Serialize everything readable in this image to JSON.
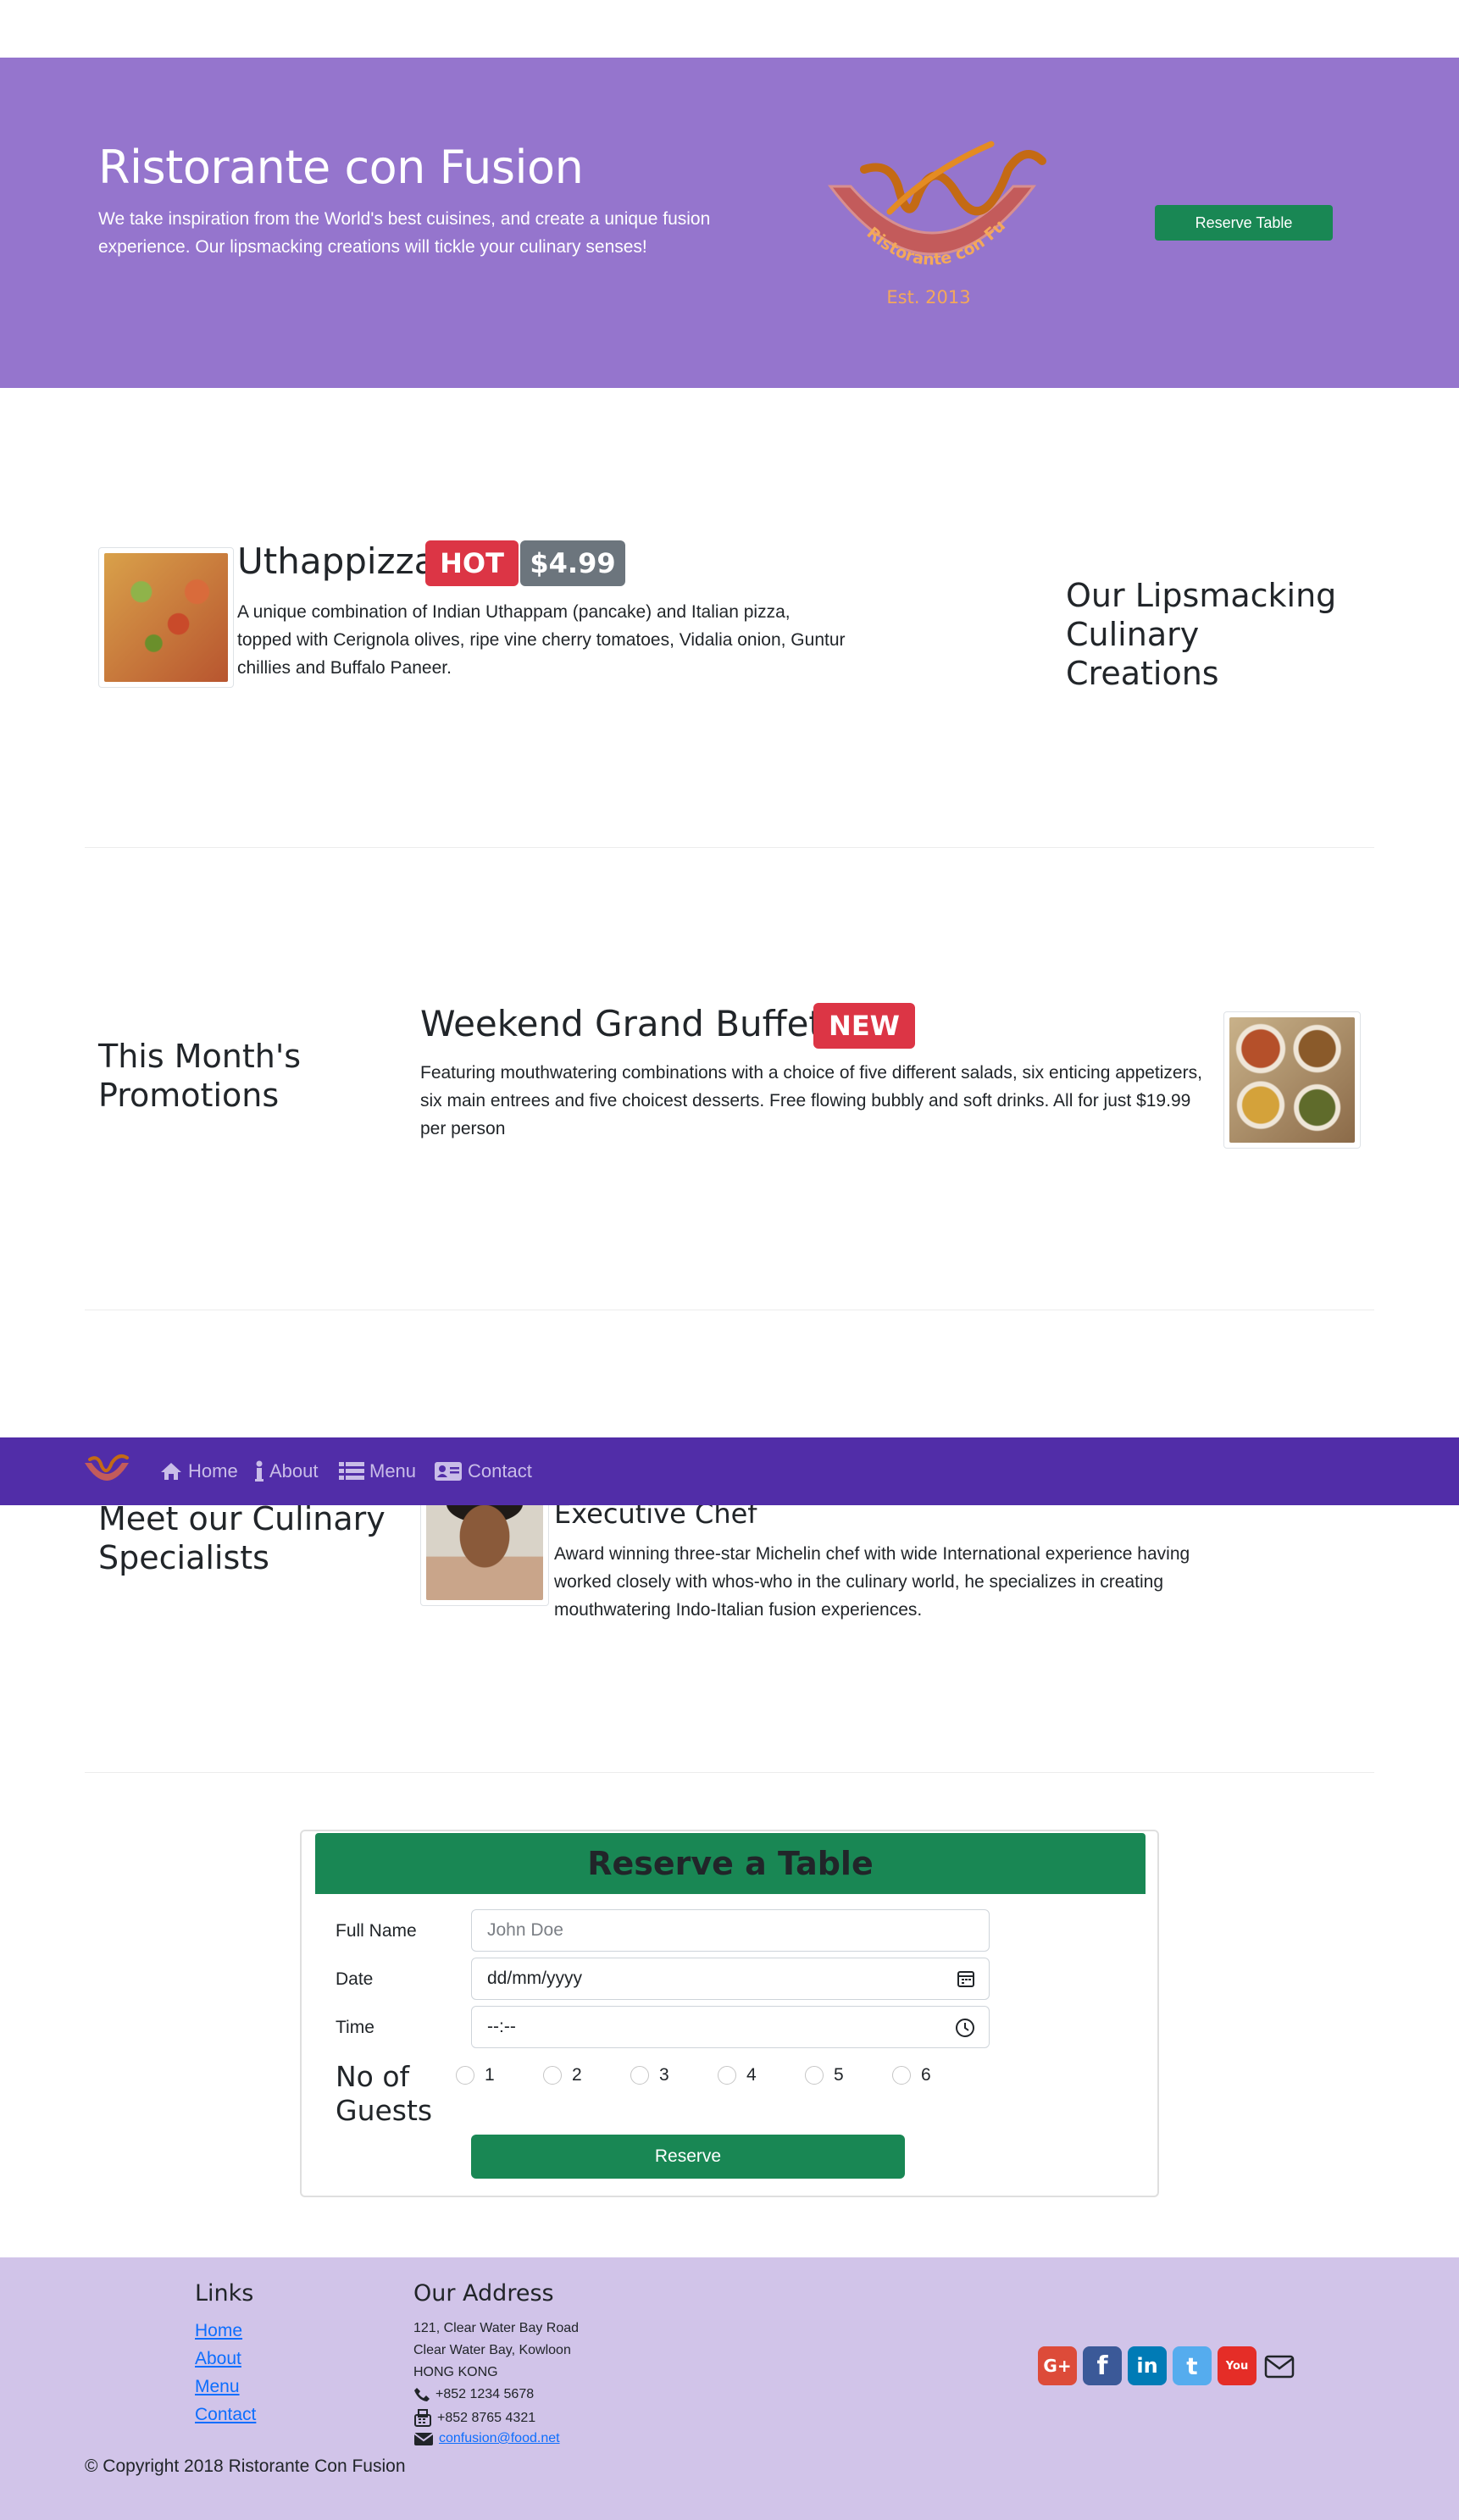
{
  "jumbotron": {
    "title": "Ristorante con Fusion",
    "description": "We take inspiration from the World's best cuisines, and create a unique fusion experience. Our lipsmacking creations will tickle your culinary senses!",
    "logo_text": "Ristorante con Fusion",
    "logo_est": "Est. 2013",
    "reserve_button": "Reserve Table"
  },
  "dish": {
    "name": "Uthappizza",
    "badge": "HOT",
    "price": "$4.99",
    "description": "A unique combination of Indian Uthappam (pancake) and Italian pizza, topped with Cerignola olives, ripe vine cherry tomatoes, Vidalia onion, Guntur chillies and Buffalo Paneer.",
    "section_heading": "Our Lipsmacking Culinary Creations"
  },
  "promotion": {
    "section_heading": "This Month's Promotions",
    "name": "Weekend Grand Buffet",
    "badge": "NEW",
    "description": "Featuring mouthwatering combinations with a choice of five different salads, six enticing appetizers, six main entrees and five choicest desserts. Free flowing bubbly and soft drinks. All for just $19.99 per person"
  },
  "navbar": {
    "items": [
      {
        "label": "Home",
        "icon": "home-icon"
      },
      {
        "label": "About",
        "icon": "info-icon"
      },
      {
        "label": "Menu",
        "icon": "list-icon"
      },
      {
        "label": "Contact",
        "icon": "address-card-icon"
      }
    ]
  },
  "leader": {
    "section_heading": "Meet our Culinary Specialists",
    "title": "Executive Chef",
    "description": "Award winning three-star Michelin chef with wide International experience having worked closely with whos-who in the culinary world, he specializes in creating mouthwatering Indo-Italian fusion experiences."
  },
  "reservation": {
    "header": "Reserve a Table",
    "full_name_label": "Full Name",
    "full_name_placeholder": "John Doe",
    "date_label": "Date",
    "date_placeholder": "dd/mm/yyyy",
    "time_label": "Time",
    "time_placeholder": "--:--",
    "guests_label": "No of Guests",
    "guest_options": [
      "1",
      "2",
      "3",
      "4",
      "5",
      "6"
    ],
    "submit": "Reserve"
  },
  "footer": {
    "links_heading": "Links",
    "links": [
      "Home",
      "About",
      "Menu",
      "Contact"
    ],
    "address_heading": "Our Address",
    "address_lines": [
      "121, Clear Water Bay Road",
      "Clear Water Bay, Kowloon",
      "HONG KONG"
    ],
    "phone": "+852 1234 5678",
    "fax": "+852 8765 4321",
    "email": "confusion@food.net",
    "copyright": "© Copyright 2018 Ristorante Con Fusion",
    "social": [
      {
        "name": "google-plus",
        "glyph": "G+",
        "color": "#dd4b39"
      },
      {
        "name": "facebook",
        "glyph": "f",
        "color": "#3b5998"
      },
      {
        "name": "linkedin",
        "glyph": "in",
        "color": "#007bb6"
      },
      {
        "name": "twitter",
        "glyph": "t",
        "color": "#55acee"
      },
      {
        "name": "youtube",
        "glyph": "You",
        "color": "#e52d27"
      }
    ]
  }
}
